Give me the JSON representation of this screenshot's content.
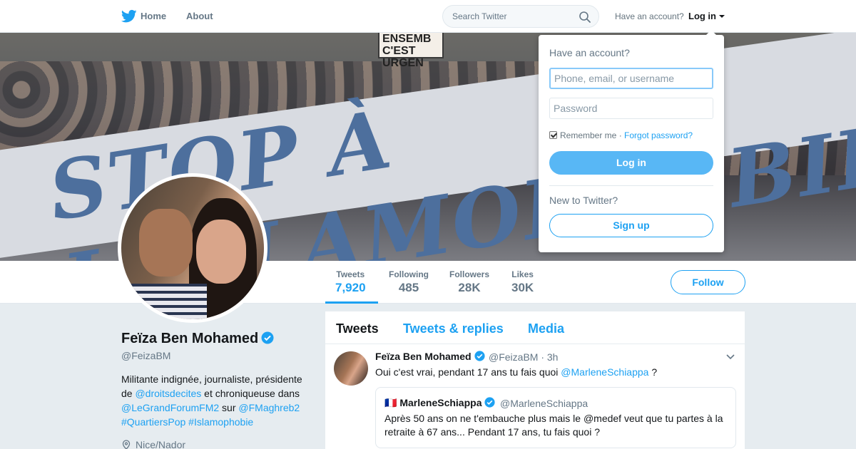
{
  "nav": {
    "home_label": "Home",
    "about_label": "About",
    "search_placeholder": "Search Twitter",
    "have_account": "Have an account?",
    "login_label": "Log in"
  },
  "banner": {
    "banner_text": "STOP À L'ISLAMOPHOBIE",
    "placard_line1": "ENSEMB",
    "placard_line2": "C'EST URGEN"
  },
  "profile": {
    "name": "Feïza Ben Mohamed",
    "handle": "@FeizaBM",
    "bio_1": "Militante indignée, journaliste, présidente de ",
    "bio_link1": "@droitsdecites",
    "bio_2": " et chroniqueuse dans ",
    "bio_link2": "@LeGrandForumFM2",
    "bio_3": " sur ",
    "bio_link3": "@FMaghreb2",
    "bio_hashtags": "#QuartiersPop #Islamophobie",
    "location": "Nice/Nador"
  },
  "stats": [
    {
      "label": "Tweets",
      "value": "7,920"
    },
    {
      "label": "Following",
      "value": "485"
    },
    {
      "label": "Followers",
      "value": "28K"
    },
    {
      "label": "Likes",
      "value": "30K"
    }
  ],
  "follow_label": "Follow",
  "tabs": [
    "Tweets",
    "Tweets & replies",
    "Media"
  ],
  "tweet": {
    "name": "Feïza Ben Mohamed",
    "handle_time": "@FeizaBM · 3h",
    "text_1": "Oui c'est vrai, pendant 17 ans tu fais quoi ",
    "text_mention": "@MarleneSchiappa",
    "text_2": " ?",
    "quote": {
      "flag": "🇫🇷",
      "name": "MarleneSchiappa",
      "handle": "@MarleneSchiappa",
      "text": "Après 50 ans on ne t'embauche plus mais le @medef veut que tu partes à la retraite à 67 ans... Pendant 17 ans, tu fais quoi ?"
    }
  },
  "login_dropdown": {
    "heading": "Have an account?",
    "username_placeholder": "Phone, email, or username",
    "password_placeholder": "Password",
    "remember": "Remember me",
    "separator": " · ",
    "forgot": "Forgot password?",
    "login_button": "Log in",
    "new_to": "New to Twitter?",
    "signup_button": "Sign up"
  },
  "colors": {
    "accent": "#1da1f2",
    "background": "#e6ecf0",
    "login_button": "#58b7f5"
  }
}
